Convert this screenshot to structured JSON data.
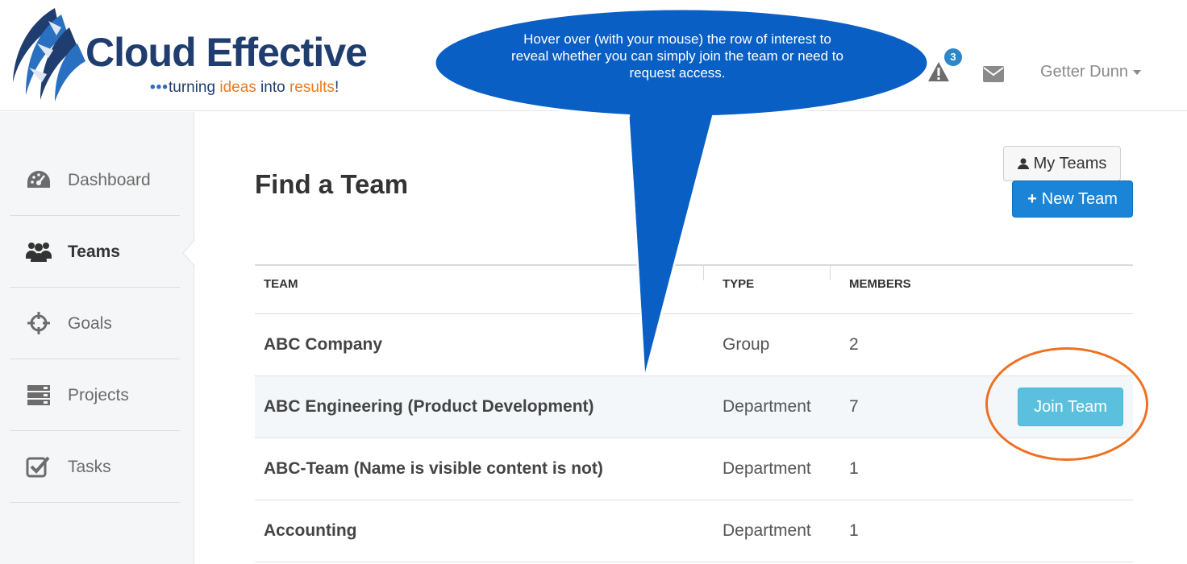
{
  "header": {
    "logo": {
      "name": "Cloud Effective",
      "tagline_parts": [
        "turning ",
        "ideas",
        " into ",
        "results",
        "!"
      ]
    },
    "alerts": {
      "icon": "warning-icon",
      "count": "3"
    },
    "messages": {
      "icon": "envelope-icon"
    },
    "user": {
      "name": "Getter Dunn",
      "icon": "caret-down-icon"
    }
  },
  "sidebar": {
    "items": [
      {
        "label": "Dashboard",
        "icon": "dashboard-icon",
        "active": false
      },
      {
        "label": "Teams",
        "icon": "users-icon",
        "active": true
      },
      {
        "label": "Goals",
        "icon": "crosshair-icon",
        "active": false
      },
      {
        "label": "Projects",
        "icon": "stack-icon",
        "active": false
      },
      {
        "label": "Tasks",
        "icon": "checkbox-icon",
        "active": false
      }
    ]
  },
  "main": {
    "title": "Find a Team",
    "my_teams_label": "My Teams",
    "new_team_label": "New Team",
    "table": {
      "headers": [
        "Team",
        "Type",
        "Members"
      ],
      "rows": [
        {
          "team": "ABC Company",
          "type": "Group",
          "members": "2"
        },
        {
          "team": "ABC Engineering (Product Development)",
          "type": "Department",
          "members": "7",
          "action": "Join Team"
        },
        {
          "team": "ABC-Team (Name is visible content is not)",
          "type": "Department",
          "members": "1"
        },
        {
          "team": "Accounting",
          "type": "Department",
          "members": "1"
        }
      ]
    }
  },
  "callout": {
    "text": "Hover over (with your mouse) the row of interest  to reveal whether you can simply join the team or need to request access."
  },
  "colors": {
    "brand_navy": "#1f3d6e",
    "accent_orange": "#ef7b1e",
    "primary_blue": "#1c84d6",
    "info_cyan": "#5bc0de",
    "callout_blue": "#0a5fc4",
    "ring_orange": "#f07022"
  }
}
